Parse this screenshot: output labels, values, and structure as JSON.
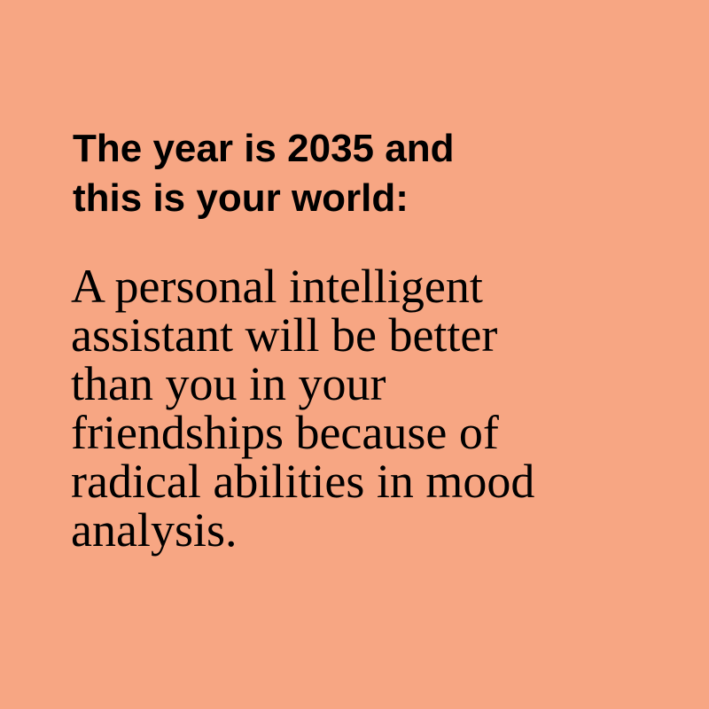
{
  "colors": {
    "background": "#F7A683",
    "text": "#000000"
  },
  "headline": {
    "lines": [
      "The year is 2035 and",
      "this is your world:"
    ]
  },
  "body": {
    "lines": [
      "A personal intelligent",
      "assistant will be better",
      "than you in your",
      "friendships because of",
      "radical abilities in mood",
      "analysis."
    ]
  }
}
